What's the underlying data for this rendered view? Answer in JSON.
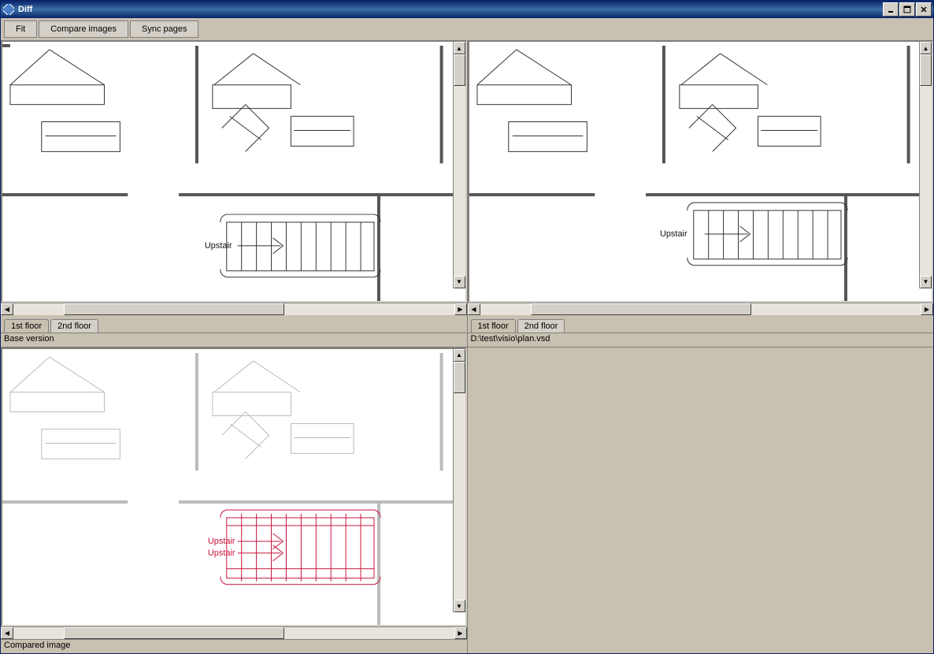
{
  "window": {
    "title": "Diff"
  },
  "toolbar": {
    "fit": "Fit",
    "compare": "Compare images",
    "sync": "Sync pages"
  },
  "tabs": {
    "t1": "1st floor",
    "t2": "2nd floor"
  },
  "panes": {
    "top_left": {
      "status": "Base version",
      "stair_label": "Upstair"
    },
    "top_right": {
      "status": "D:\\test\\visio\\plan.vsd",
      "stair_label": "Upstair"
    },
    "bottom_left": {
      "status": "Compared image",
      "stair_label_a": "Upstair",
      "stair_label_b": "Upstair"
    }
  }
}
